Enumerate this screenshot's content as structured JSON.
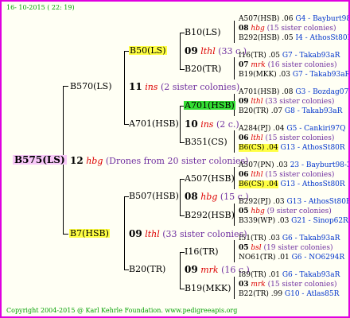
{
  "header": {
    "date": "16- 10-2015 ( 22: 19)"
  },
  "root": {
    "id": "B575(LS)",
    "count": "12",
    "race": "hbg",
    "note": "(Drones from 20 sister colonies)"
  },
  "gen1": [
    {
      "id": "B570(LS)",
      "count": "11",
      "race": "ins",
      "note": "(2 sister colonies)"
    },
    {
      "id": "B7(HSB)",
      "count": "09",
      "race": "lthl",
      "note": "(33 sister colonies)"
    }
  ],
  "gen2": [
    {
      "id": "B50(LS)",
      "count": "09",
      "race": "lthl",
      "note": "(33 c.)"
    },
    {
      "id": "A701(HSB)",
      "count": "10",
      "race": "ins",
      "note": "(2 c.)"
    },
    {
      "id": "B507(HSB)",
      "count": "08",
      "race": "hbg",
      "note": "(15 c.)"
    },
    {
      "id": "B20(TR)",
      "count": "09",
      "race": "mrk",
      "note": "(16 c.)"
    }
  ],
  "gen3": [
    {
      "id": "B10(LS)"
    },
    {
      "id": "B20(TR)"
    },
    {
      "id": "A701(HSB)"
    },
    {
      "id": "B351(CS)"
    },
    {
      "id": "A507(HSB)"
    },
    {
      "id": "B292(HSB)"
    },
    {
      "id": "I16(TR)"
    },
    {
      "id": "B19(MKK)"
    }
  ],
  "gen4": [
    {
      "top": "A507(HSB) .06",
      "topr": "G4 - Bayburt98-3",
      "count": "08",
      "race": "hbg",
      "note": "(15 sister colonies)",
      "bot": "B292(HSB) .05",
      "botr": "I4 - AthosSt80R"
    },
    {
      "top": "I16(TR) .05",
      "topr": "G7 - Takab93aR",
      "count": "07",
      "race": "mrk",
      "note": "(16 sister colonies)",
      "bot": "B19(MKK) .03",
      "botr": "G7 - Takab93aR"
    },
    {
      "top": "A701(HSB) .08",
      "topr": "G3 - Bozdag07R",
      "count": "09",
      "race": "lthl",
      "note": "(33 sister colonies)",
      "bot": "B20(TR) .07",
      "botr": "G8 - Takab93aR"
    },
    {
      "top": "A284(PJ) .04",
      "topr": "G5 - Cankiri97Q",
      "count": "06",
      "race": "lthl",
      "note": "(15 sister colonies)",
      "bot": "B6(CS) .04",
      "botr": "G13 - AthosSt80R"
    },
    {
      "top": "A507(PN) .03",
      "topr": "23 - Bayburt98-3",
      "count": "06",
      "race": "lthl",
      "note": "(15 sister colonies)",
      "bot": "B6(CS) .04",
      "botr": "G13 - AthosSt80R"
    },
    {
      "top": "B292(PJ) .03",
      "topr": "G13 - AthosSt80R",
      "count": "05",
      "race": "hbg",
      "note": "(9 sister colonies)",
      "bot": "B339(WP) .03",
      "botr": "G21 - Sinop62R"
    },
    {
      "top": "I51(TR) .03",
      "topr": "G6 - Takab93aR",
      "count": "05",
      "race": "bsl",
      "note": "(19 sister colonies)",
      "bot": "NO61(TR) .01",
      "botr": "G6 - NO6294R"
    },
    {
      "top": "I89(TR) .01",
      "topr": "G6 - Takab93aR",
      "count": "03",
      "race": "mrk",
      "note": "(15 sister colonies)",
      "bot": "B22(TR) .99",
      "botr": "G10 - Atlas85R"
    }
  ],
  "footer": {
    "text": "Copyright 2004-2015 @ Karl Kehrle Foundation.   www.pedigreeapis.org"
  }
}
